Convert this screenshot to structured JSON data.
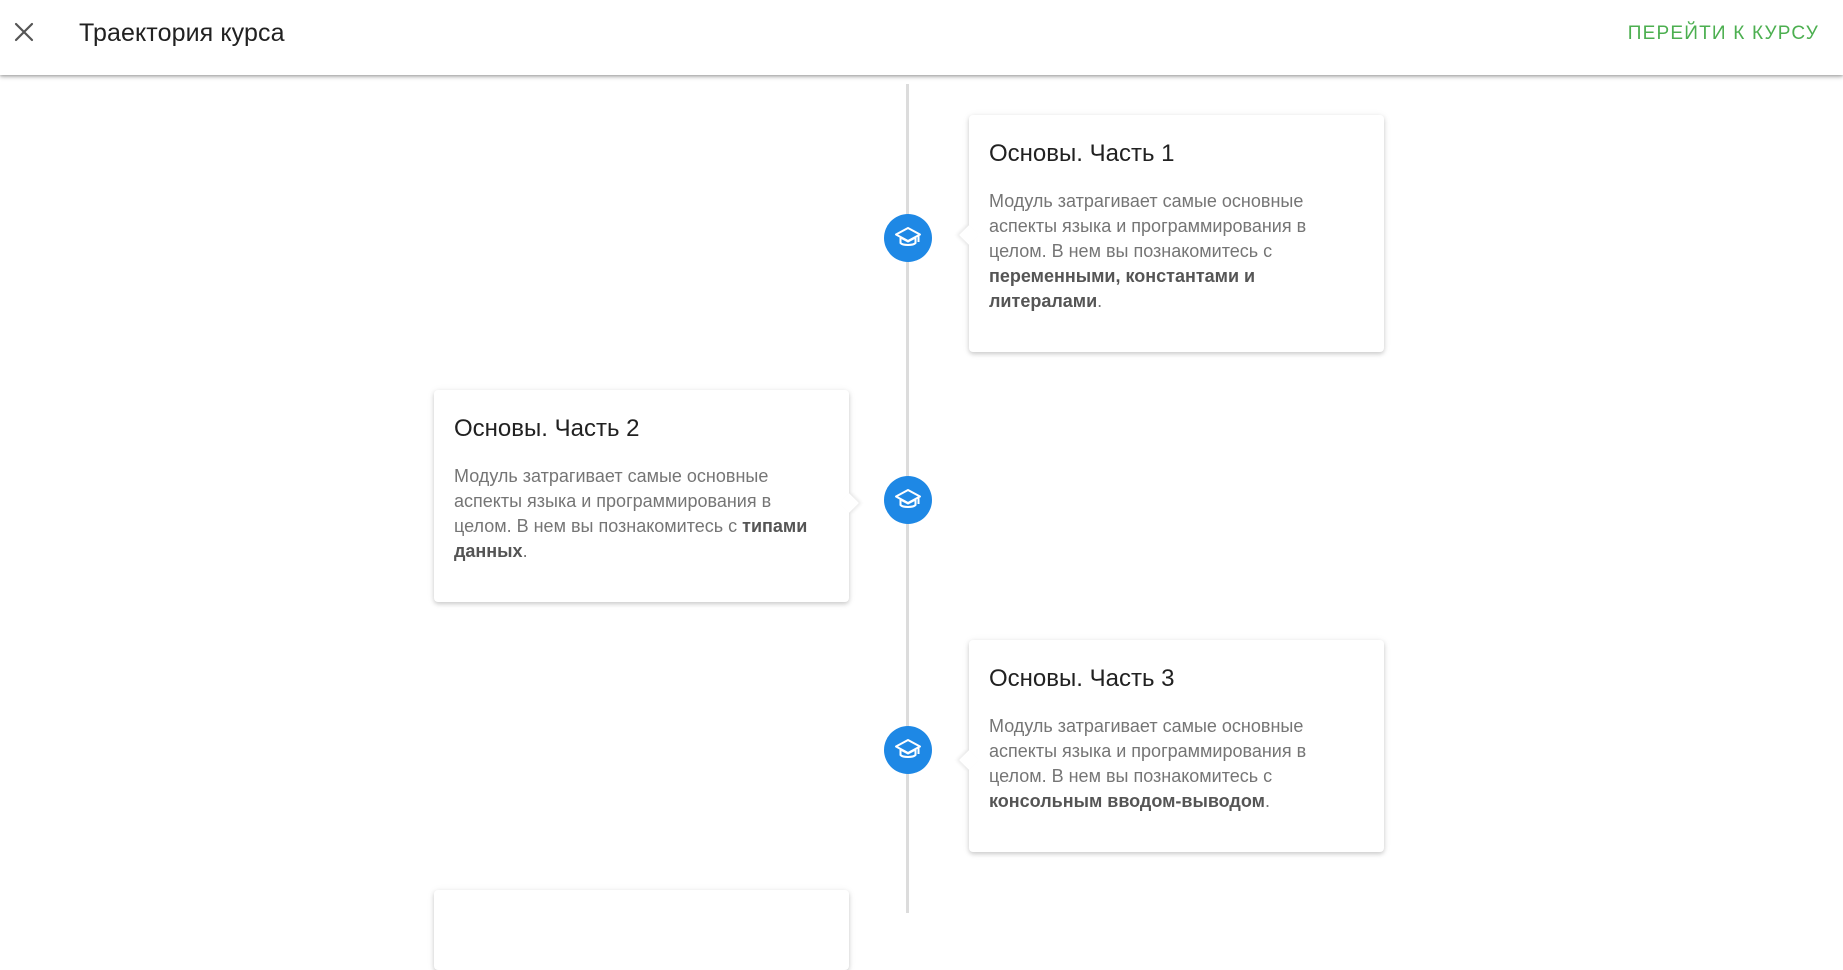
{
  "header": {
    "title": "Траектория курса",
    "go_to_course": "ПЕРЕЙТИ К КУРСУ",
    "close_icon": "close-icon"
  },
  "colors": {
    "accent": "#4caf50",
    "node": "#1e88e5",
    "line": "#dcdcdc"
  },
  "timeline": {
    "node_icon": "graduation-cap-icon",
    "modules": [
      {
        "side": "right",
        "title": "Основы. Часть 1",
        "text_before": "Модуль затрагивает самые основные аспекты языка и программирования в целом. В нем вы познакомитесь с ",
        "text_bold": "переменными, константами и литералами",
        "text_after": "."
      },
      {
        "side": "left",
        "title": "Основы. Часть 2",
        "text_before": "Модуль затрагивает самые основные аспекты языка и программирования в целом. В нем вы познакомитесь с ",
        "text_bold": "типами данных",
        "text_after": "."
      },
      {
        "side": "right",
        "title": "Основы. Часть 3",
        "text_before": "Модуль затрагивает самые основные аспекты языка и программирования в целом. В нем вы познакомитесь с ",
        "text_bold": "консольным вводом-выводом",
        "text_after": "."
      }
    ]
  }
}
